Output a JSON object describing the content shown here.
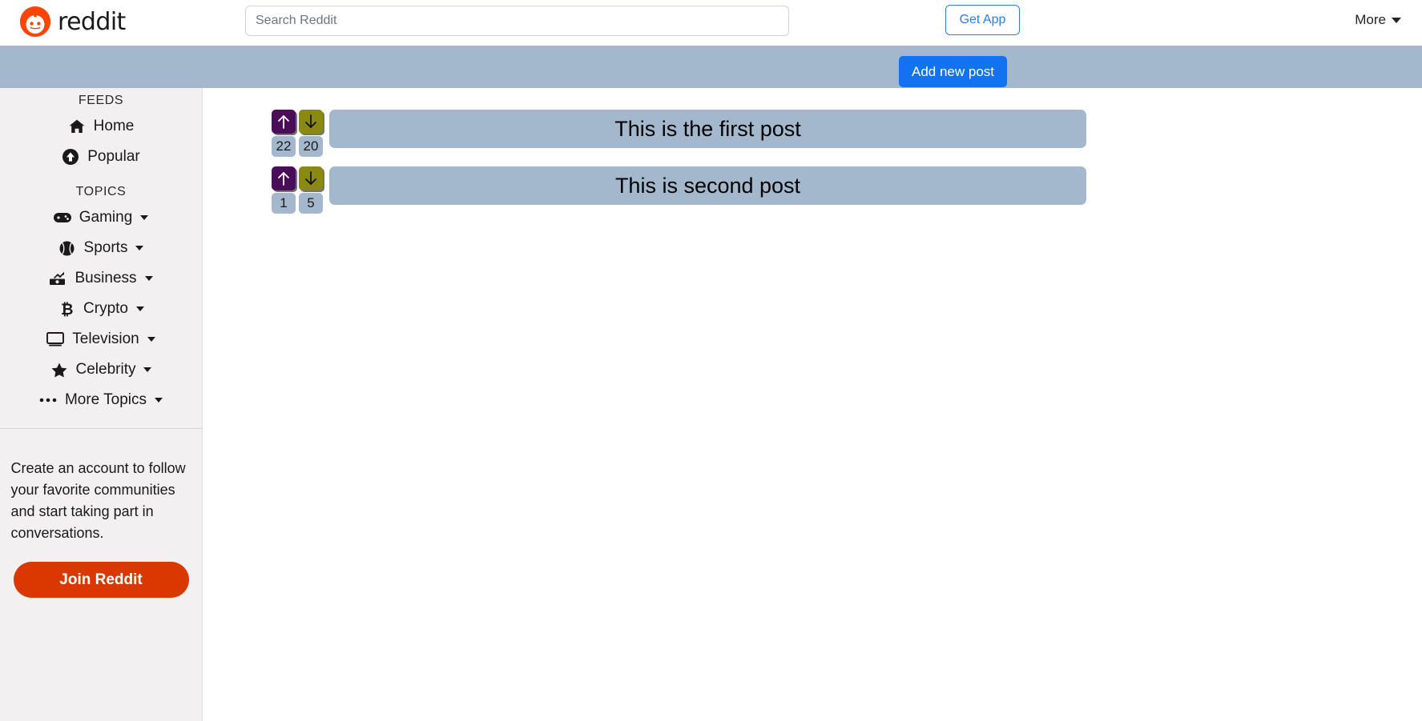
{
  "navbar": {
    "brand_text": "reddit",
    "brand_icon": "reddit-logo-icon",
    "search_placeholder": "Search Reddit",
    "search_value": "",
    "get_app_label": "Get App",
    "more_label": "More"
  },
  "action_bar": {
    "add_post_label": "Add new post"
  },
  "sidebar": {
    "feeds_label": "FEEDS",
    "feeds": [
      {
        "label": "Home",
        "icon": "home-icon"
      },
      {
        "label": "Popular",
        "icon": "popular-arrow-up-circle-icon"
      }
    ],
    "topics_label": "TOPICS",
    "topics": [
      {
        "label": "Gaming",
        "icon": "gamepad-icon"
      },
      {
        "label": "Sports",
        "icon": "baseball-icon"
      },
      {
        "label": "Business",
        "icon": "money-chart-icon"
      },
      {
        "label": "Crypto",
        "icon": "bitcoin-icon"
      },
      {
        "label": "Television",
        "icon": "monitor-icon"
      },
      {
        "label": "Celebrity",
        "icon": "star-icon"
      },
      {
        "label": "More Topics",
        "icon": "ellipsis-icon"
      }
    ],
    "promo_text": "Create an account to follow your favorite communities and start taking part in conversations.",
    "join_label": "Join Reddit"
  },
  "posts": [
    {
      "title": "This is the first post",
      "upvotes": "22",
      "downvotes": "20"
    },
    {
      "title": "This is second post",
      "upvotes": "1",
      "downvotes": "5"
    }
  ],
  "colors": {
    "brand_orange": "#ff4500",
    "join_orange": "#d93900",
    "accent_blue": "#1272f0",
    "link_blue": "#2a7bf6",
    "bar_blue_gray": "#a3b8cc",
    "sidebar_bg": "#f2f0f0",
    "upvote_purple": "#4a0d58",
    "downvote_olive": "#8a8a13"
  }
}
